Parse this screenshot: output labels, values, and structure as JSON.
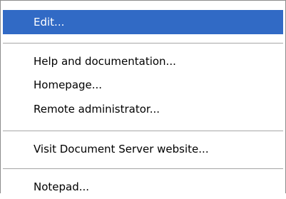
{
  "menu": {
    "items": [
      {
        "label": "Edit...",
        "selected": true
      },
      {
        "label": "Help and documentation..."
      },
      {
        "label": "Homepage..."
      },
      {
        "label": "Remote administrator..."
      },
      {
        "label": "Visit Document Server website..."
      },
      {
        "label": "Notepad..."
      }
    ]
  },
  "colors": {
    "highlight": "#316ac5",
    "highlight_text": "#ffffff",
    "separator": "#a6a6a6",
    "border": "#8c8c8c"
  }
}
